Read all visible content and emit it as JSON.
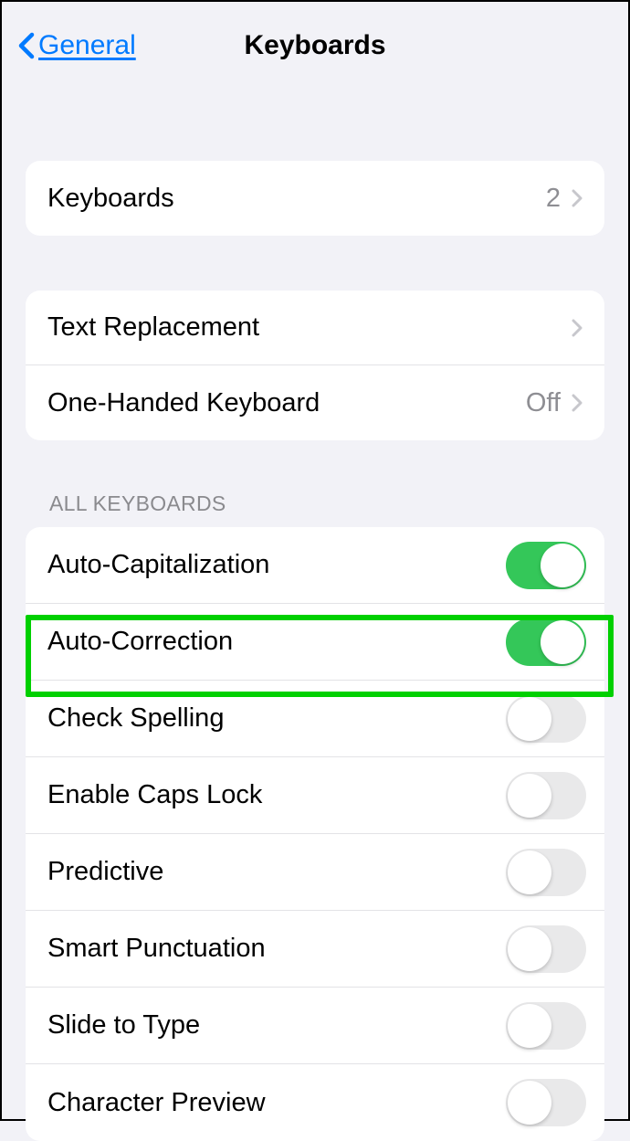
{
  "nav": {
    "back_label": "General",
    "title": "Keyboards"
  },
  "group1": {
    "items": [
      {
        "label": "Keyboards",
        "value": "2",
        "disclosure": true
      }
    ]
  },
  "group2": {
    "items": [
      {
        "label": "Text Replacement",
        "disclosure": true
      },
      {
        "label": "One-Handed Keyboard",
        "value": "Off",
        "disclosure": true
      }
    ]
  },
  "all_keyboards": {
    "header": "ALL KEYBOARDS",
    "items": [
      {
        "label": "Auto-Capitalization",
        "toggle": true
      },
      {
        "label": "Auto-Correction",
        "toggle": true
      },
      {
        "label": "Check Spelling",
        "toggle": false
      },
      {
        "label": "Enable Caps Lock",
        "toggle": false
      },
      {
        "label": "Predictive",
        "toggle": false
      },
      {
        "label": "Smart Punctuation",
        "toggle": false
      },
      {
        "label": "Slide to Type",
        "toggle": false
      },
      {
        "label": "Character Preview",
        "toggle": false
      }
    ]
  }
}
